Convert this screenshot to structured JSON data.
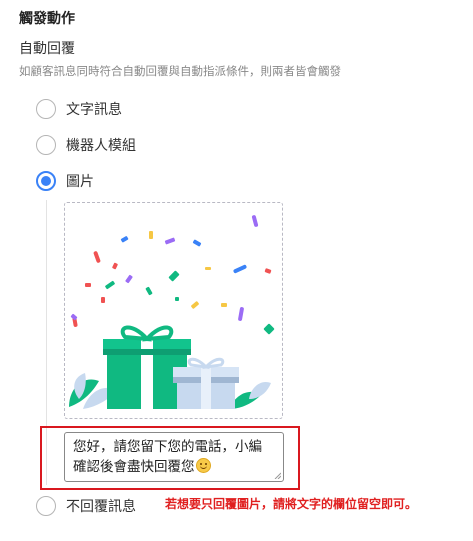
{
  "section": {
    "title": "觸發動作"
  },
  "auto_reply": {
    "title": "自動回覆",
    "hint": "如顧客訊息同時符合自動回覆與自動指派條件，則兩者皆會觸發"
  },
  "options": [
    {
      "label": "文字訊息",
      "selected": false
    },
    {
      "label": "機器人模組",
      "selected": false
    },
    {
      "label": "圖片",
      "selected": true
    },
    {
      "label": "不回覆訊息",
      "selected": false
    }
  ],
  "image_preview": {
    "icon": "gift-confetti-illustration"
  },
  "message": {
    "line1": "您好，請您留下您的電話，小編",
    "line2": "確認後會盡快回覆您",
    "emoji": "smiling-face-icon"
  },
  "annotation": {
    "text": "若想要只回覆圖片，請將文字的欄位留空即可。",
    "color": "#e02020"
  },
  "colors": {
    "accent": "#3a82f7",
    "gift_green": "#10b981",
    "gift_blue": "#c7d9ef",
    "highlight": "#d9181f"
  }
}
